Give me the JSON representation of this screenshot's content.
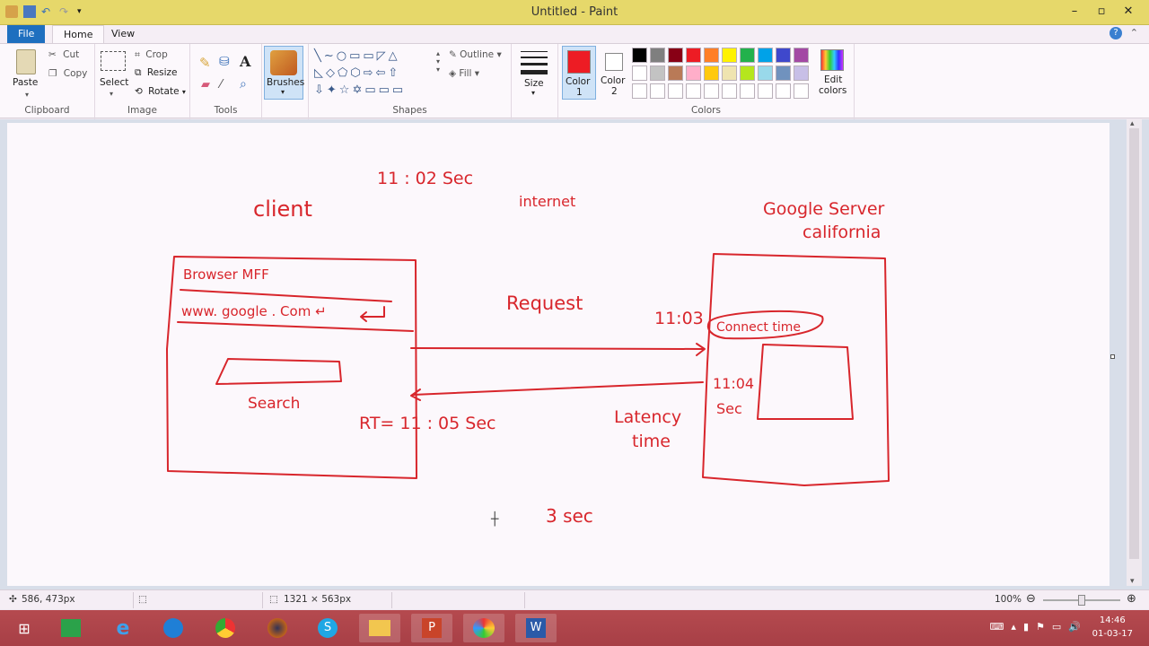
{
  "window": {
    "title": "Untitled - Paint",
    "minimize": "–",
    "maximize": "▫",
    "close": "✕"
  },
  "tabs": {
    "file": "File",
    "home": "Home",
    "view": "View"
  },
  "ribbon": {
    "clipboard": {
      "label": "Clipboard",
      "paste": "Paste",
      "cut": "Cut",
      "copy": "Copy"
    },
    "image": {
      "label": "Image",
      "select": "Select",
      "crop": "Crop",
      "resize": "Resize",
      "rotate": "Rotate"
    },
    "tools": {
      "label": "Tools"
    },
    "brushes": {
      "label": "Brushes"
    },
    "shapes": {
      "label": "Shapes",
      "outline": "Outline",
      "fill": "Fill"
    },
    "size": {
      "label": "Size"
    },
    "colors": {
      "label": "Colors",
      "color1": "Color\n1",
      "color1_a": "Color",
      "color1_b": "1",
      "color2_a": "Color",
      "color2_b": "2",
      "edit_a": "Edit",
      "edit_b": "colors",
      "color1_value": "#ed1c24",
      "color2_value": "#ffffff",
      "palette_row1": [
        "#000000",
        "#7f7f7f",
        "#880015",
        "#ed1c24",
        "#ff7f27",
        "#fff200",
        "#22b14c",
        "#00a2e8",
        "#3f48cc",
        "#a349a4"
      ],
      "palette_row2": [
        "#ffffff",
        "#c3c3c3",
        "#b97a57",
        "#ffaec9",
        "#ffc90e",
        "#efe4b0",
        "#b5e61d",
        "#99d9ea",
        "#7092be",
        "#c8bfe7"
      ]
    }
  },
  "canvas": {
    "annotations": {
      "time_top": "11 : 02  Sec",
      "client": "client",
      "internet": "internet",
      "google_server": "Google Server",
      "california": "california",
      "browser": "Browser  MFF",
      "url": "www. google . Com  ↵",
      "search": "Search",
      "request": "Request",
      "t_1103": "11:03",
      "connect_time": "Connect time",
      "t_1104": "11:04",
      "sec": "Sec",
      "rt": "RT= 11 : 05  Sec",
      "latency": "Latency",
      "time": "time",
      "three_sec": "3  sec"
    }
  },
  "status": {
    "cursor": "586, 473px",
    "dimensions": "1321 × 563px",
    "zoom": "100%"
  },
  "taskbar": {
    "time": "14:46",
    "date": "01-03-17"
  }
}
